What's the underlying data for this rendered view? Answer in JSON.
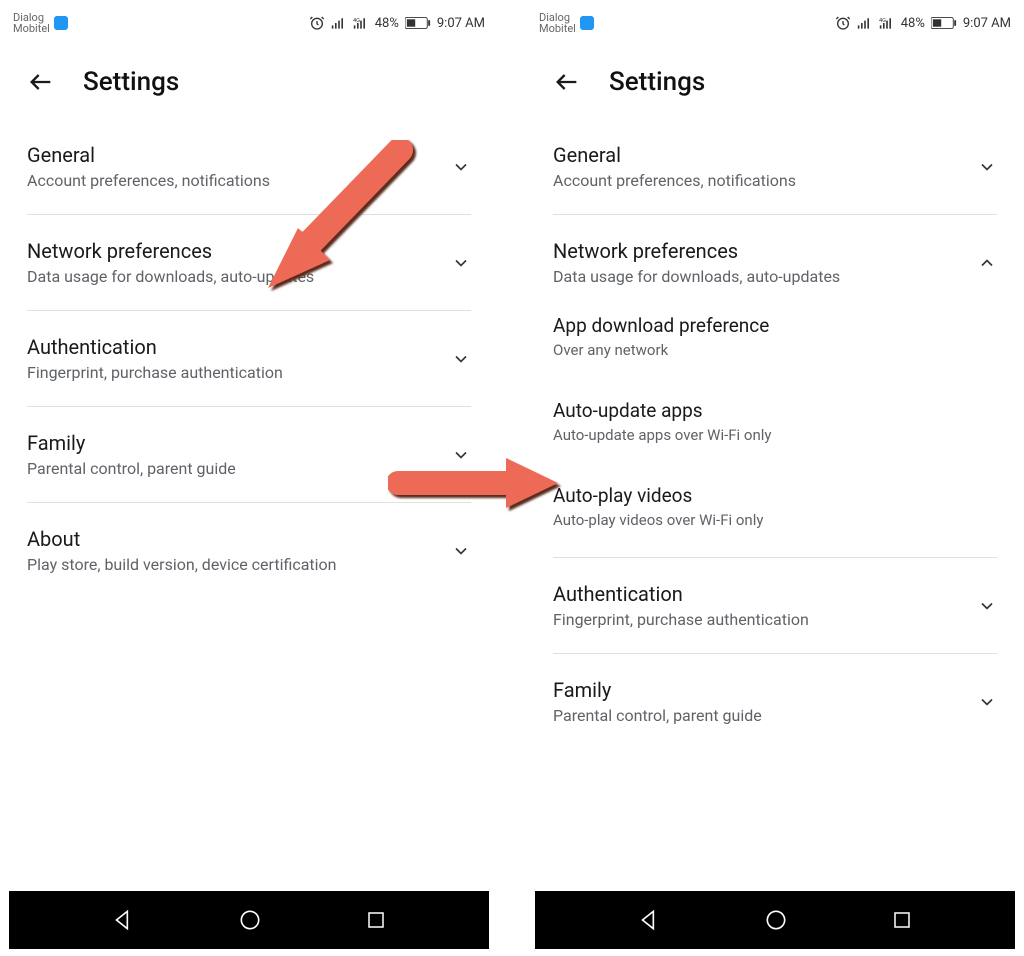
{
  "statusbar": {
    "carrier_line1": "Dialog",
    "carrier_line2": "Mobitel",
    "battery_text": "48%",
    "time": "9:07 AM"
  },
  "header": {
    "title": "Settings"
  },
  "left": {
    "general_title": "General",
    "general_sub": "Account preferences, notifications",
    "network_title": "Network preferences",
    "network_sub": "Data usage for downloads, auto-updates",
    "auth_title": "Authentication",
    "auth_sub": "Fingerprint, purchase authentication",
    "family_title": "Family",
    "family_sub": "Parental control, parent guide",
    "about_title": "About",
    "about_sub": "Play store, build version, device certification"
  },
  "right": {
    "general_title": "General",
    "general_sub": "Account preferences, notifications",
    "network_title": "Network preferences",
    "network_sub": "Data usage for downloads, auto-updates",
    "appdl_title": "App download preference",
    "appdl_sub": "Over any network",
    "autoupd_title": "Auto-update apps",
    "autoupd_sub": "Auto-update apps over Wi-Fi only",
    "autoplay_title": "Auto-play videos",
    "autoplay_sub": "Auto-play videos over Wi-Fi only",
    "auth_title": "Authentication",
    "auth_sub": "Fingerprint, purchase authentication",
    "family_title": "Family",
    "family_sub": "Parental control, parent guide"
  }
}
